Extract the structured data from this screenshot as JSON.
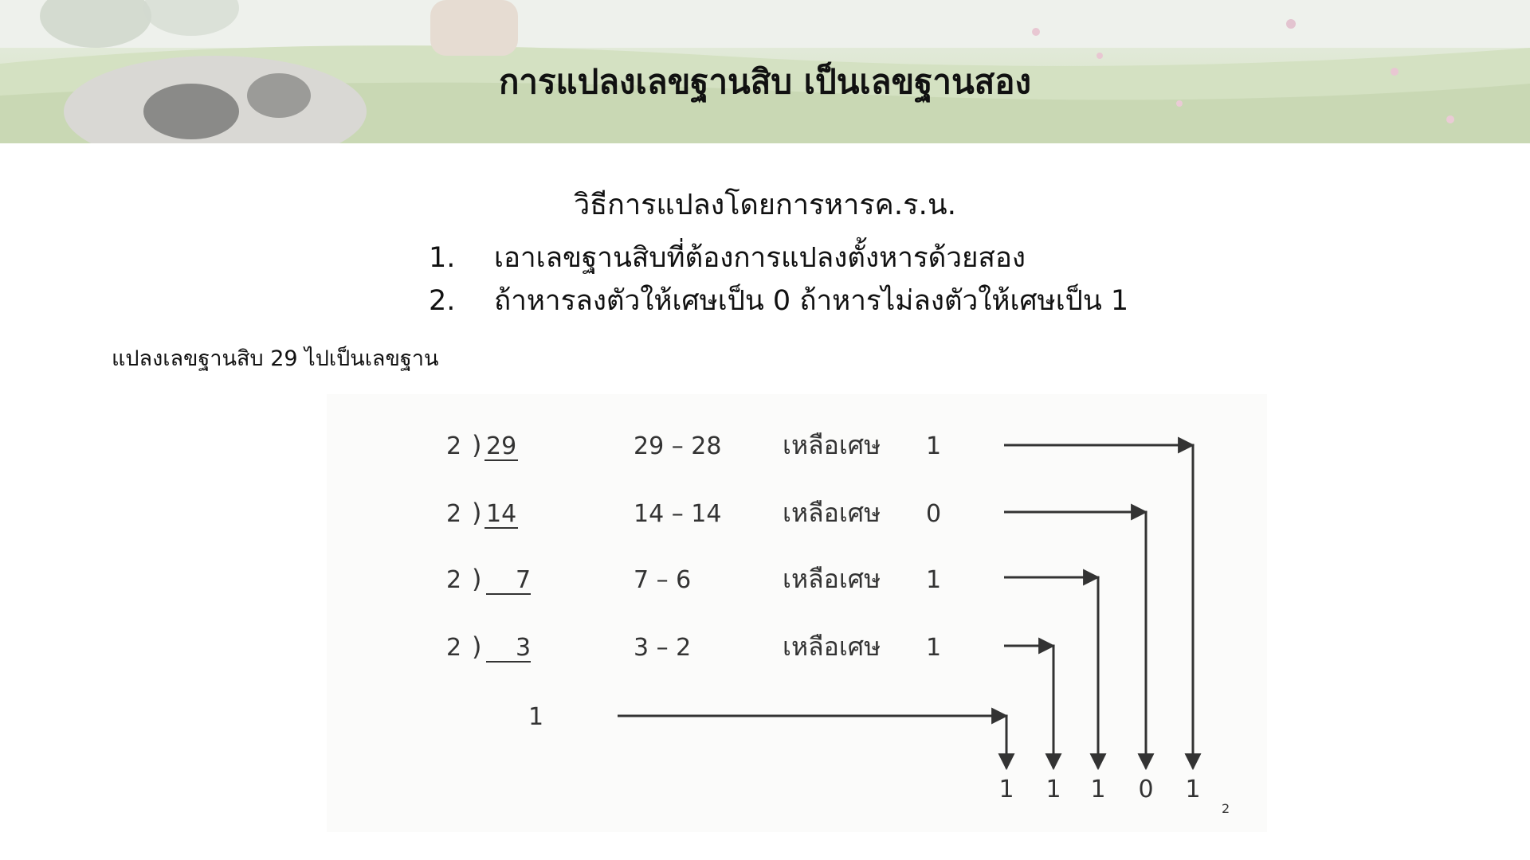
{
  "header": {
    "title": "การแปลงเลขฐานสิบ เป็นเลขฐานสอง"
  },
  "method": {
    "subtitle": "วิธีการแปลงโดยการหารค.ร.น.",
    "steps": [
      {
        "number": "1.",
        "text": "เอาเลขฐานสิบที่ต้องการแปลงตั้งหารด้วยสอง"
      },
      {
        "number": "2.",
        "text": "ถ้าหารลงตัวให้เศษเป็น 0 ถ้าหารไม่ลงตัวให้เศษเป็น 1"
      }
    ]
  },
  "example": {
    "label": "แปลงเลขฐานสิบ 29 ไปเป็นเลขฐาน",
    "rows": [
      {
        "divisor": "2",
        "dividend": "29",
        "subtraction": "29 – 28",
        "remainder_label": "เหลือเศษ",
        "remainder": "1"
      },
      {
        "divisor": "2",
        "dividend": "14",
        "subtraction": "14 – 14",
        "remainder_label": "เหลือเศษ",
        "remainder": "0"
      },
      {
        "divisor": "2",
        "dividend": "7",
        "subtraction": "7 – 6",
        "remainder_label": "เหลือเศษ",
        "remainder": "1"
      },
      {
        "divisor": "2",
        "dividend": "3",
        "subtraction": "3 – 2",
        "remainder_label": "เหลือเศษ",
        "remainder": "1"
      }
    ],
    "final_quotient": "1",
    "result_digits": [
      "1",
      "1",
      "1",
      "0",
      "1"
    ],
    "result_base": "2"
  },
  "colors": {
    "text": "#111111",
    "scan_ink": "#333333",
    "header_grass": "#cfdcbd"
  }
}
